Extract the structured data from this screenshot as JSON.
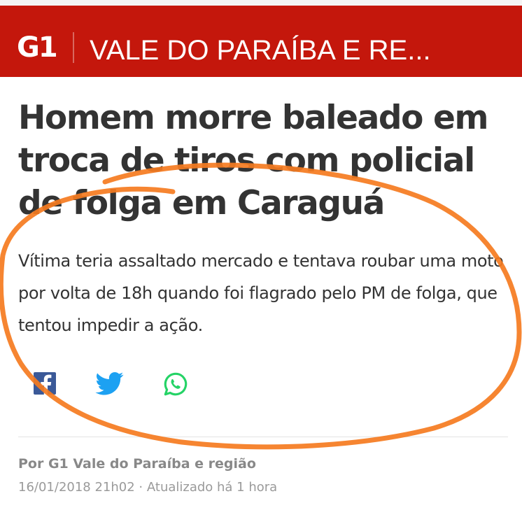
{
  "header": {
    "logo": "G1",
    "section_title": "VALE DO PARAÍBA E RE..."
  },
  "article": {
    "headline": "Homem morre baleado em troca de tiros com policial de folga em Caraguá",
    "subtitle": "Vítima teria assaltado mercado e tentava roubar uma moto por volta de 18h quando foi flagrado pelo PM de folga, que tentou impedir a ação.",
    "byline": "Por G1 Vale do Paraíba e região",
    "published": "16/01/2018 21h02",
    "separator": "·",
    "updated": "Atualizado há 1 hora"
  },
  "share": {
    "icons": [
      "facebook-icon",
      "twitter-icon",
      "whatsapp-icon"
    ]
  },
  "colors": {
    "brand_red": "#c4170c",
    "headline_text": "#333333",
    "meta_text": "#999999",
    "facebook": "#3b5998",
    "twitter": "#1da1f2",
    "whatsapp": "#25d366",
    "annotation_orange": "#f57b20"
  }
}
